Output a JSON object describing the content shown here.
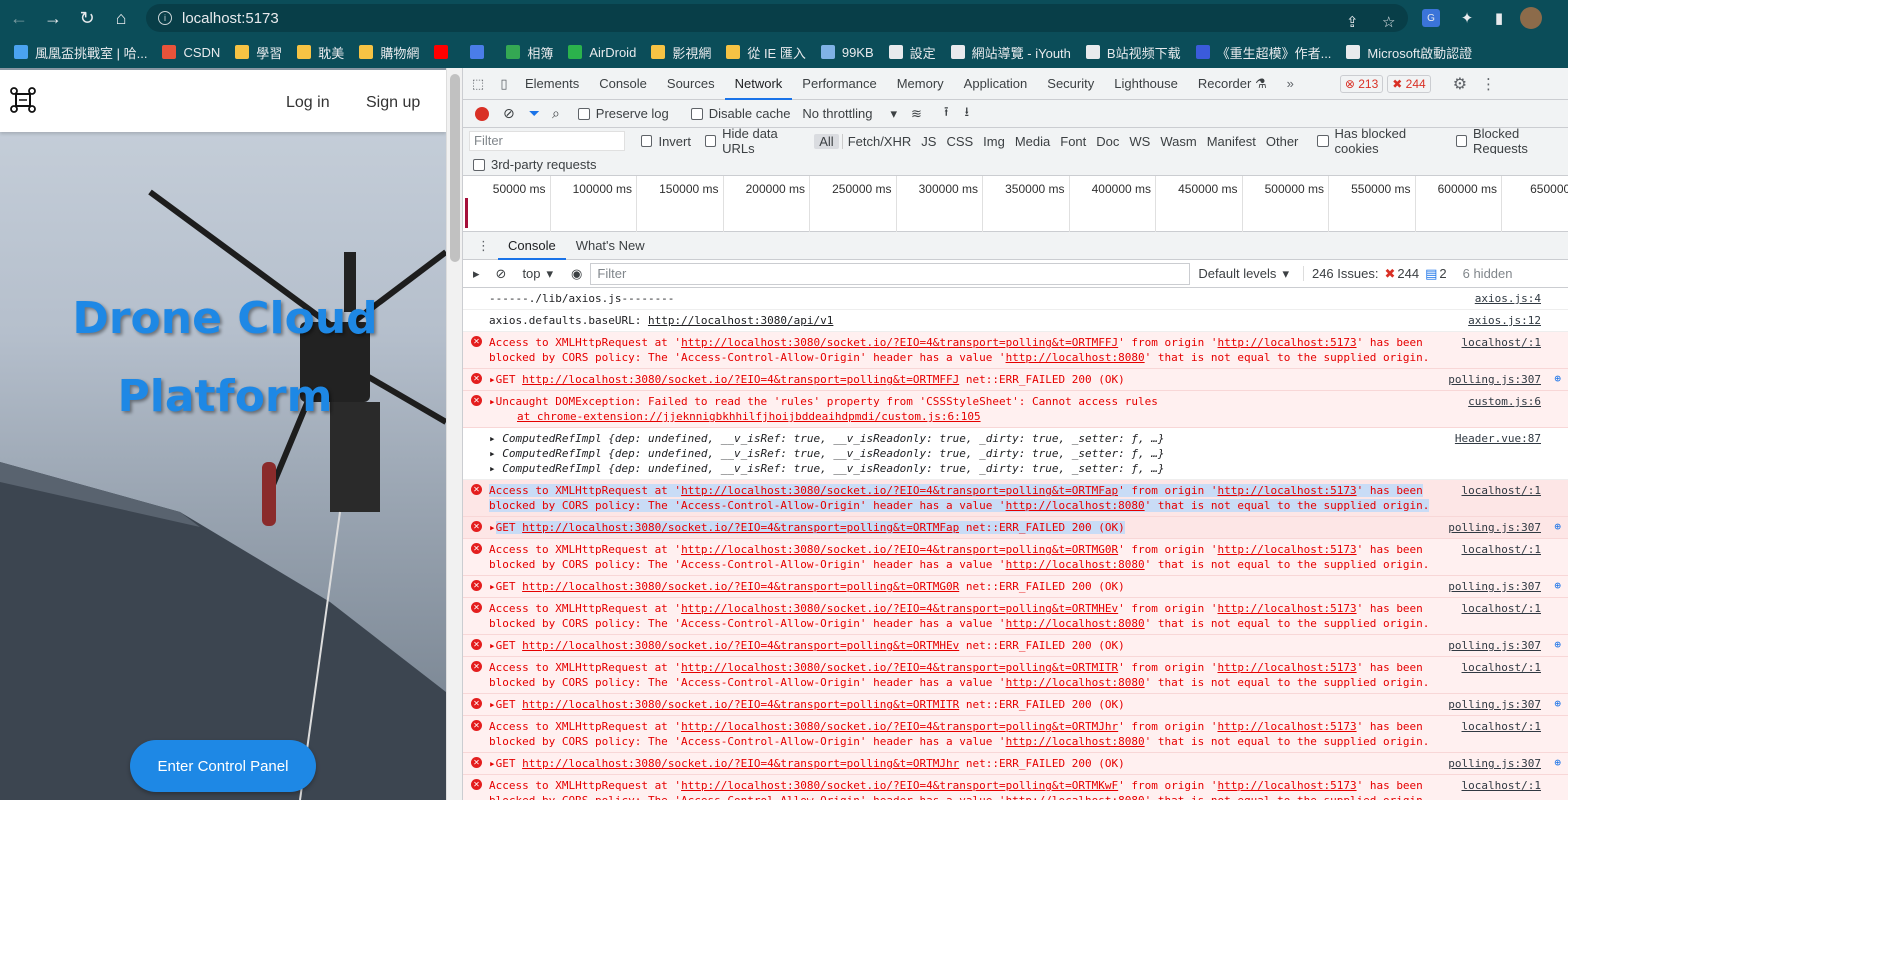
{
  "browser": {
    "url": "localhost:5173",
    "bookmarks": [
      {
        "label": "風凰盃挑戰室 | 哈...",
        "color": "#4aa3f0"
      },
      {
        "label": "CSDN",
        "color": "#e8533a"
      },
      {
        "label": "學習",
        "color": "#f6c344"
      },
      {
        "label": "耽美",
        "color": "#f6c344"
      },
      {
        "label": "購物網",
        "color": "#f6c344"
      },
      {
        "label": "",
        "color": "#ff0000"
      },
      {
        "label": "",
        "color": "#4a7de8"
      },
      {
        "label": "相簿",
        "color": "#34a853"
      },
      {
        "label": "AirDroid",
        "color": "#2bb24c"
      },
      {
        "label": "影視網",
        "color": "#f6c344"
      },
      {
        "label": "從 IE 匯入",
        "color": "#f6c344"
      },
      {
        "label": "99KB",
        "color": "#7fb2e6"
      },
      {
        "label": "設定",
        "color": "#e8eaed"
      },
      {
        "label": "網站導覽 - iYouth",
        "color": "#e8eaed"
      },
      {
        "label": "B站视频下载",
        "color": "#e8eaed"
      },
      {
        "label": "《重生超模》作者...",
        "color": "#3b5bdb"
      },
      {
        "label": "Microsoft啟動認證",
        "color": "#e8eaed"
      }
    ]
  },
  "app": {
    "login": "Log in",
    "signup": "Sign up",
    "title_line1": "Drone Cloud",
    "title_line2": "Platform",
    "enter_button": "Enter Control Panel"
  },
  "devtools": {
    "tabs": [
      "Elements",
      "Console",
      "Sources",
      "Network",
      "Performance",
      "Memory",
      "Application",
      "Security",
      "Lighthouse",
      "Recorder ⚗"
    ],
    "active_tab": "Network",
    "error_count": "213",
    "warning_count": "244",
    "network_toolbar": {
      "preserve_log": "Preserve log",
      "disable_cache": "Disable cache",
      "throttling": "No throttling"
    },
    "filter": {
      "placeholder": "Filter",
      "invert": "Invert",
      "hide_data_urls": "Hide data URLs",
      "types": [
        "All",
        "Fetch/XHR",
        "JS",
        "CSS",
        "Img",
        "Media",
        "Font",
        "Doc",
        "WS",
        "Wasm",
        "Manifest",
        "Other"
      ],
      "blocked_cookies": "Has blocked cookies",
      "blocked_requests": "Blocked Requests",
      "third_party": "3rd-party requests"
    },
    "timeline_ticks": [
      "50000 ms",
      "100000 ms",
      "150000 ms",
      "200000 ms",
      "250000 ms",
      "300000 ms",
      "350000 ms",
      "400000 ms",
      "450000 ms",
      "500000 ms",
      "550000 ms",
      "600000 ms",
      "650000 m"
    ],
    "drawer_tabs": [
      "Console",
      "What's New"
    ],
    "console_toolbar": {
      "context": "top",
      "filter_placeholder": "Filter",
      "levels": "Default levels",
      "issues_label": "246 Issues:",
      "issues_errors": "244",
      "issues_info": "2",
      "hidden": "6 hidden"
    },
    "log": [
      {
        "type": "log",
        "text": "------./lib/axios.js--------",
        "src": "axios.js:4"
      },
      {
        "type": "log",
        "text": "axios.defaults.baseURL:  ",
        "link": "http://localhost:3080/api/v1",
        "src": "axios.js:12"
      },
      {
        "type": "cors",
        "id": "ORTMFFJ",
        "src": "localhost/:1"
      },
      {
        "type": "get",
        "id": "ORTMFFJ",
        "src": "polling.js:307"
      },
      {
        "type": "dom",
        "line1": "Uncaught DOMException: Failed to read the 'rules' property from 'CSSStyleSheet': Cannot access rules",
        "line2": "at chrome-extension://jjeknnigbkhhilfjhoijbddeaihdpmdi/custom.js:6:105",
        "src": "custom.js:6"
      },
      {
        "type": "obj",
        "src": "Header.vue:87"
      },
      {
        "type": "cors",
        "id": "ORTMFap",
        "src": "localhost/:1",
        "sel": true
      },
      {
        "type": "get",
        "id": "ORTMFap",
        "src": "polling.js:307",
        "sel": true
      },
      {
        "type": "cors",
        "id": "ORTMG0R",
        "src": "localhost/:1"
      },
      {
        "type": "get",
        "id": "ORTMG0R",
        "src": "polling.js:307"
      },
      {
        "type": "cors",
        "id": "ORTMHEv",
        "src": "localhost/:1"
      },
      {
        "type": "get",
        "id": "ORTMHEv",
        "src": "polling.js:307"
      },
      {
        "type": "cors",
        "id": "ORTMITR",
        "src": "localhost/:1"
      },
      {
        "type": "get",
        "id": "ORTMITR",
        "src": "polling.js:307"
      },
      {
        "type": "cors",
        "id": "ORTMJhr",
        "src": "localhost/:1"
      },
      {
        "type": "get",
        "id": "ORTMJhr",
        "src": "polling.js:307"
      },
      {
        "type": "cors",
        "id": "ORTMKwF",
        "src": "localhost/:1"
      }
    ],
    "strings": {
      "cors_prefix": "Access to XMLHttpRequest at '",
      "socket_url": "http://localhost:3080/socket.io/?EIO=4&transport=polling&t=",
      "cors_mid": "' from origin '",
      "origin": "http://localhost:5173",
      "cors_end1": "' has been",
      "cors_line2a": "blocked by CORS policy: The 'Access-Control-Allow-Origin' header has a value '",
      "allowed": "http://localhost:8080",
      "cors_line2b": "' that is not equal to the supplied origin.",
      "get_prefix": "GET ",
      "get_suffix": " net::ERR_FAILED 200 (OK)",
      "obj_line": "ComputedRefImpl {dep: undefined, __v_isRef: true, __v_isReadonly: true, _dirty: true, _setter: ƒ, …}"
    }
  }
}
